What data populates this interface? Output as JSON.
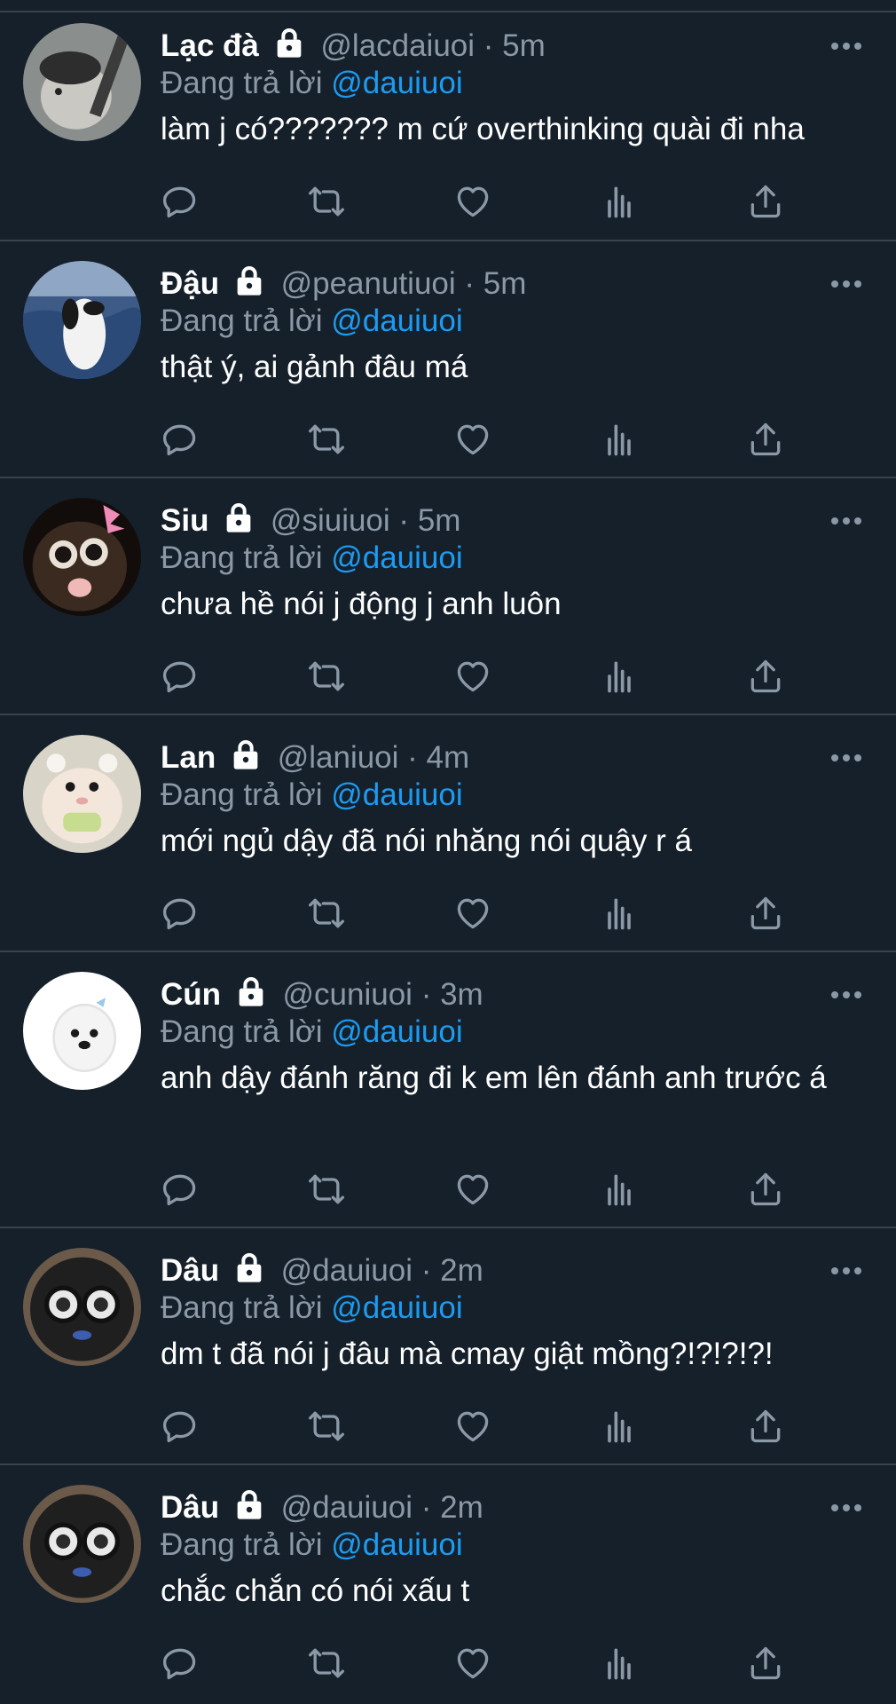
{
  "tweets": [
    {
      "name": "Lạc đà",
      "handle": "@lacdaiuoi",
      "sep": "·",
      "time": "5m",
      "reply_prefix": "Đang trả lời",
      "reply_to": "@dauiuoi",
      "text": "làm j có??????? m cứ overthinking quài đi nha"
    },
    {
      "name": "Đậu",
      "handle": "@peanutiuoi",
      "sep": "·",
      "time": "5m",
      "reply_prefix": "Đang trả lời",
      "reply_to": "@dauiuoi",
      "text": "thật ý, ai gảnh đâu má"
    },
    {
      "name": "Siu",
      "handle": "@siuiuoi",
      "sep": "·",
      "time": "5m",
      "reply_prefix": "Đang trả lời",
      "reply_to": "@dauiuoi",
      "text": "chưa hề nói j động j anh luôn"
    },
    {
      "name": "Lan",
      "handle": "@laniuoi",
      "sep": "·",
      "time": "4m",
      "reply_prefix": "Đang trả lời",
      "reply_to": "@dauiuoi",
      "text": "mới ngủ dậy đã nói nhăng nói quậy r á"
    },
    {
      "name": "Cún",
      "handle": "@cuniuoi",
      "sep": "·",
      "time": "3m",
      "reply_prefix": "Đang trả lời",
      "reply_to": "@dauiuoi",
      "text": "anh dậy đánh răng đi k em lên đánh anh trước á"
    },
    {
      "name": "Dâu",
      "handle": "@dauiuoi",
      "sep": "·",
      "time": "2m",
      "reply_prefix": "Đang trả lời",
      "reply_to": "@dauiuoi",
      "text": "dm t đã nói j đâu mà cmay giật mồng?!?!?!?!"
    },
    {
      "name": "Dâu",
      "handle": "@dauiuoi",
      "sep": "·",
      "time": "2m",
      "reply_prefix": "Đang trả lời",
      "reply_to": "@dauiuoi",
      "text": "chắc chắn có nói xấu t"
    }
  ],
  "action_icons": [
    "reply-icon",
    "retweet-icon",
    "like-icon",
    "analytics-icon",
    "share-icon"
  ],
  "colors": {
    "background": "#15202b",
    "divider": "#38444d",
    "muted": "#8b98a5",
    "mention": "#1d9bf0",
    "text": "#ffffff"
  }
}
